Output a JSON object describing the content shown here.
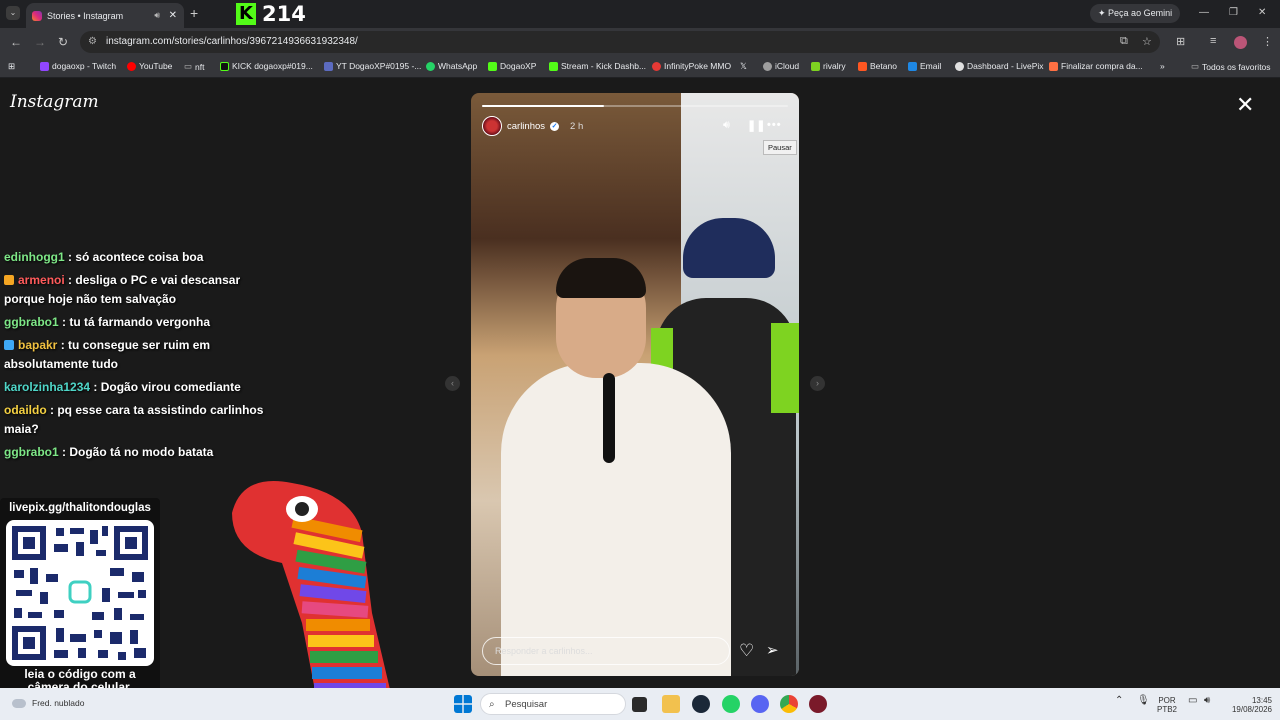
{
  "browser": {
    "tab_title": "Stories • Instagram",
    "tab_mute_icon": "speaker-icon",
    "kick_overlay_number": "214",
    "gemini_label": "Peça ao Gemini",
    "url": "instagram.com/stories/carlinhos/3967214936631932348/"
  },
  "bookmarks": [
    {
      "label": "dogaoxp - Twitch",
      "color": "#9146ff"
    },
    {
      "label": "YouTube",
      "color": "#ff0000"
    },
    {
      "label": "nft",
      "color": "#bbbbbb"
    },
    {
      "label": "KICK dogaoxp#019...",
      "color": "#53fc18"
    },
    {
      "label": "YT DogaoXP#0195 -...",
      "color": "#5c6bc0"
    },
    {
      "label": "WhatsApp",
      "color": "#25d366"
    },
    {
      "label": "DogaoXP",
      "color": "#53fc18"
    },
    {
      "label": "Stream - Kick Dashb...",
      "color": "#53fc18"
    },
    {
      "label": "InfinityPoke MMO",
      "color": "#e53935"
    },
    {
      "label": "",
      "color": "#ffffff"
    },
    {
      "label": "iCloud",
      "color": "#9e9e9e"
    },
    {
      "label": "rivalry",
      "color": "#7ed321"
    },
    {
      "label": "Betano",
      "color": "#ff5722"
    },
    {
      "label": "Email",
      "color": "#1e88e5"
    },
    {
      "label": "Dashboard - LivePix",
      "color": "#e0e0e0"
    },
    {
      "label": "Finalizar compra da...",
      "color": "#ff7043"
    }
  ],
  "bookmarks_all": "Todos os favoritos",
  "instagram": {
    "logo": "Instagram",
    "story": {
      "username": "carlinhos",
      "time": "2 h",
      "progress": 0.4,
      "tooltip": "Pausar",
      "reply_placeholder": "Responder a carlinhos..."
    }
  },
  "chat": [
    {
      "user": "edinhogg1",
      "user_color": "#7ee787",
      "text": ": só acontece coisa boa",
      "badge": ""
    },
    {
      "user": "armenoi",
      "user_color": "#ff5b5b",
      "text": ": desliga o PC e vai descansar porque hoje não tem salvação",
      "badge": "#f5a623"
    },
    {
      "user": "ggbrabo1",
      "user_color": "#7ee787",
      "text": ": tu tá farmando vergonha",
      "badge": ""
    },
    {
      "user": "bapakr",
      "user_color": "#f0c040",
      "text": ": tu consegue ser ruim em absolutamente tudo",
      "badge": "#3fa9f5"
    },
    {
      "user": "karolzinha1234",
      "user_color": "#4fd6c8",
      "text": ": Dogão virou comediante",
      "badge": ""
    },
    {
      "user": "odaildo",
      "user_color": "#f5d142",
      "text": ": pq esse cara ta assistindo carlinhos maia?",
      "badge": ""
    },
    {
      "user": "ggbrabo1",
      "user_color": "#7ee787",
      "text": ": Dogão tá no modo batata",
      "badge": ""
    }
  ],
  "qr": {
    "url": "livepix.gg/thalitondouglas",
    "caption_1": "leia o código com a",
    "caption_2": "câmera do celular."
  },
  "taskbar": {
    "weather": "Fred. nublado",
    "search": "Pesquisar",
    "lang_1": "POR",
    "lang_2": "PTB2",
    "time": "13:45",
    "date": "19/08/2026"
  }
}
